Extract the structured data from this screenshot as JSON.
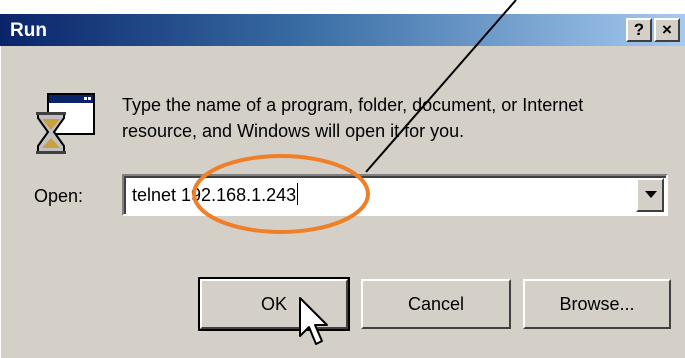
{
  "window": {
    "title": "Run",
    "help_glyph": "?",
    "close_glyph": "×"
  },
  "content": {
    "instruction": "Type the name of a program, folder, document, or Internet resource, and Windows will open it for you.",
    "icon": "run-app-icon"
  },
  "open_field": {
    "label": "Open:",
    "value": "telnet 192.168.1.243"
  },
  "buttons": {
    "ok": "OK",
    "cancel": "Cancel",
    "browse": "Browse..."
  },
  "annotation": {
    "highlight_color": "#f07f28",
    "line_color": "#000000"
  }
}
